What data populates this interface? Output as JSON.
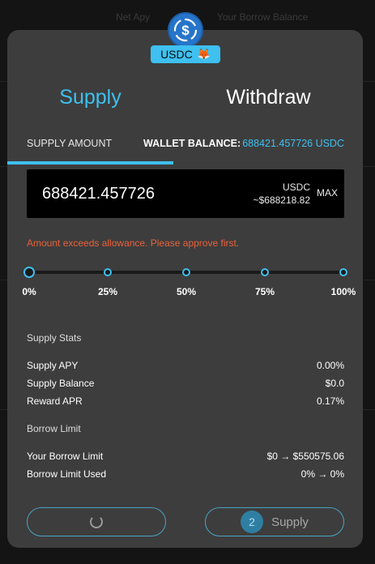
{
  "background": {
    "nav_items": [
      "Net Apy",
      "Your Borrow Balance"
    ]
  },
  "token": {
    "icon": "usdc-dollar-icon",
    "symbol": "USDC",
    "wallet_icon": "metamask-fox-icon",
    "wallet_glyph": "🦊"
  },
  "tabs": [
    {
      "label": "Supply",
      "active": true
    },
    {
      "label": "Withdraw",
      "active": false
    }
  ],
  "supply_amount_label": "SUPPLY AMOUNT",
  "wallet_balance_label": "WALLET BALANCE:",
  "wallet_balance_value": "688421.457726 USDC",
  "amount": {
    "value": "688421.457726",
    "unit": "USDC",
    "usd_value": "~$688218.82",
    "max_label": "MAX"
  },
  "warning": "Amount exceeds allowance. Please approve first.",
  "slider": {
    "value_percent": 0,
    "ticks": [
      "0%",
      "25%",
      "50%",
      "75%",
      "100%"
    ]
  },
  "supply_stats": {
    "title": "Supply Stats",
    "rows": [
      {
        "label": "Supply APY",
        "value": "0.00%"
      },
      {
        "label": "Supply Balance",
        "value": "$0.0"
      },
      {
        "label": "Reward APR",
        "value": "0.17%"
      }
    ]
  },
  "borrow_limit": {
    "title": "Borrow Limit",
    "rows": [
      {
        "label": "Your Borrow Limit",
        "value": "$0 → $550575.06"
      },
      {
        "label": "Borrow Limit Used",
        "value": "0% → 0%"
      }
    ]
  },
  "buttons": {
    "approve": {
      "state": "loading",
      "icon": "spinner-icon"
    },
    "supply": {
      "step": "2",
      "label": "Supply"
    }
  },
  "colors": {
    "accent": "#3ec0f0",
    "warning": "#e8623c",
    "usdc_blue": "#2775ca",
    "modal_bg": "#3d3d3d"
  }
}
